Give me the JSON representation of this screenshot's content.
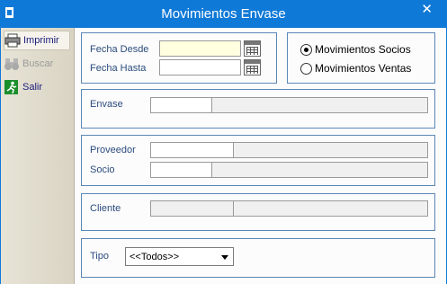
{
  "window": {
    "title": "Movimientos Envase",
    "close_glyph": "✕"
  },
  "toolbar": {
    "items": [
      {
        "label": "Imprimir",
        "icon": "printer-icon",
        "enabled": true
      },
      {
        "label": "Buscar",
        "icon": "binoculars-icon",
        "enabled": false
      },
      {
        "label": "Salir",
        "icon": "exit-icon",
        "enabled": true
      }
    ]
  },
  "dates": {
    "from_label": "Fecha Desde",
    "from_value": "",
    "to_label": "Fecha Hasta",
    "to_value": ""
  },
  "movement_type": {
    "options": [
      {
        "label": "Movimientos Socios",
        "selected": true
      },
      {
        "label": "Movimientos Ventas",
        "selected": false
      }
    ]
  },
  "envase": {
    "label": "Envase",
    "code": "",
    "description": ""
  },
  "proveedor": {
    "label": "Proveedor",
    "code": "",
    "description": ""
  },
  "socio": {
    "label": "Socio",
    "code": "",
    "description": ""
  },
  "cliente": {
    "label": "Cliente",
    "code": "",
    "description": ""
  },
  "tipo": {
    "label": "Tipo",
    "selected": "<<Todos>>"
  },
  "colors": {
    "title_bar": "#0f79d7",
    "label_text": "#2b4c7e",
    "group_border": "#5b87b6",
    "active_field": "#ffffe0"
  }
}
